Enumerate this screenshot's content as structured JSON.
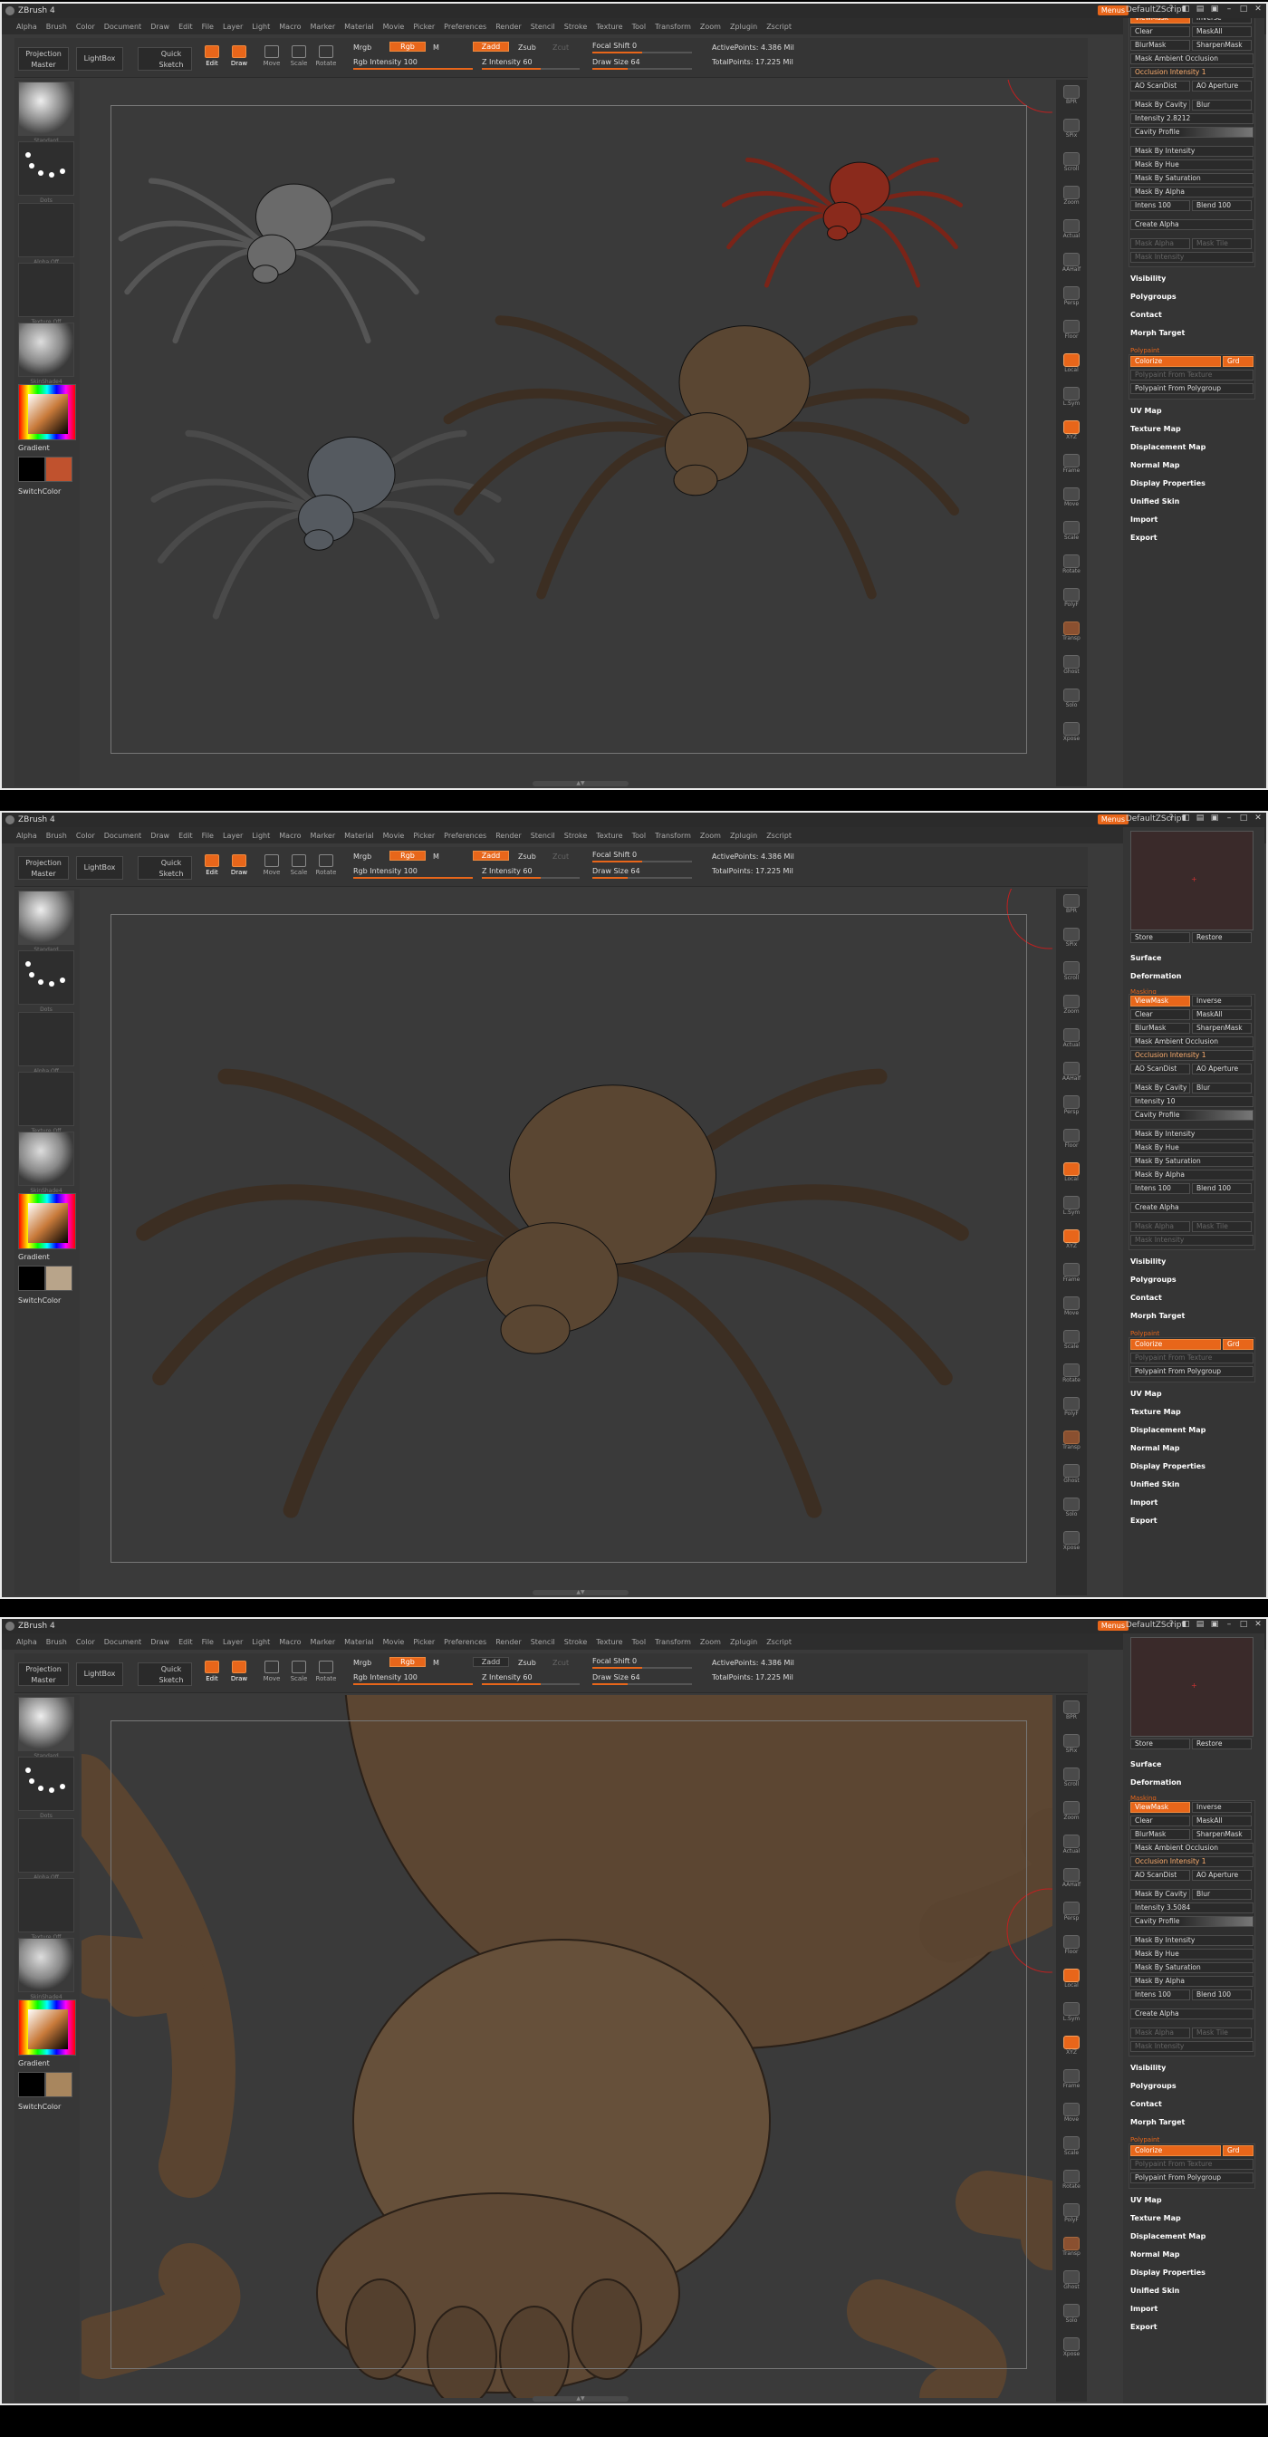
{
  "app_title": "ZBrush 4",
  "menu": [
    "Alpha",
    "Brush",
    "Color",
    "Document",
    "Draw",
    "Edit",
    "File",
    "Layer",
    "Light",
    "Macro",
    "Marker",
    "Material",
    "Movie",
    "Picker",
    "Preferences",
    "Render",
    "Stencil",
    "Stroke",
    "Texture",
    "Tool",
    "Transform",
    "Zoom",
    "Zplugin",
    "Zscript"
  ],
  "menus_btn": "Menus",
  "default_script": "DefaultZScript",
  "toolbar": {
    "projection": "Projection Master",
    "lightbox": "LightBox",
    "quicksketch": "Quick Sketch",
    "edit": "Edit",
    "draw": "Draw",
    "move": "Move",
    "scale": "Scale",
    "rotate": "Rotate",
    "mrgb": "Mrgb",
    "rgb": "Rgb",
    "m": "M",
    "zadd": "Zadd",
    "zsub": "Zsub",
    "zcut": "Zcut",
    "rgb_intensity": "Rgb Intensity 100",
    "z_intensity": "Z Intensity 60",
    "focal_shift": "Focal Shift 0",
    "draw_size": "Draw Size 64",
    "active_points": "ActivePoints: 4.386 Mil",
    "total_points": "TotalPoints: 17.225 Mil"
  },
  "left": {
    "standard": "Standard",
    "dots": "Dots",
    "alpha": "Alpha Off",
    "texture": "Texture Off",
    "material": "SkinShade4",
    "gradient": "Gradient",
    "switchcolor": "SwitchColor"
  },
  "right_shelf": [
    "BPR",
    "SPix",
    "Scroll",
    "Zoom",
    "Actual",
    "AAHalf",
    "Persp",
    "Floor",
    "Local",
    "L.Sym",
    "XYZ",
    "Frame",
    "Move",
    "Scale",
    "Rotate",
    "PolyF",
    "Transp",
    "Ghost",
    "Solo",
    "Xpose"
  ],
  "panel": {
    "store": "Store",
    "restore": "Restore",
    "surface": "Surface",
    "deformation": "Deformation",
    "masking": "Masking",
    "viewmask": "ViewMask",
    "inverse": "Inverse",
    "clear": "Clear",
    "maskall": "MaskAll",
    "blurmask": "BlurMask",
    "sharpenmask": "SharpenMask",
    "mask_ambient": "Mask Ambient Occlusion",
    "occlusion": "Occlusion Intensity 1",
    "ao_scandist": "AO ScanDist",
    "ao_aperture": "AO Aperture",
    "mask_cavity": "Mask By Cavity",
    "blur": "Blur",
    "cavity_profile": "Cavity Profile",
    "mask_intensity": "Mask By Intensity",
    "mask_hue": "Mask By Hue",
    "mask_sat": "Mask By Saturation",
    "mask_alpha": "Mask By Alpha",
    "intens": "Intens 100",
    "blend": "Blend 100",
    "create_alpha": "Create Alpha",
    "mask_alpha2": "Mask Alpha",
    "mask_tile": "Mask Tile",
    "mask_intensity2": "Mask Intensity",
    "visibility": "Visibility",
    "polygroups": "Polygroups",
    "contact": "Contact",
    "morph": "Morph Target",
    "polypaint": "Polypaint",
    "colorize": "Colorize",
    "grd": "Grd",
    "pp_texture": "Polypaint From Texture",
    "pp_polygroup": "Polypaint From Polygroup",
    "uvmap": "UV Map",
    "texmap": "Texture Map",
    "dispmap": "Displacement Map",
    "normalmap": "Normal Map",
    "display": "Display Properties",
    "unified": "Unified Skin",
    "import": "Import",
    "export": "Export"
  },
  "panel_intensity": [
    "Intensity 2.8212",
    "Intensity 10",
    "Intensity 3.5084"
  ],
  "colors": {
    "accent": "#e8661a",
    "bg": "#3a3a3a",
    "canvas": "#2e2e2e",
    "spider_red": "#8a2a1c",
    "spider_brown": "#5a4632"
  }
}
